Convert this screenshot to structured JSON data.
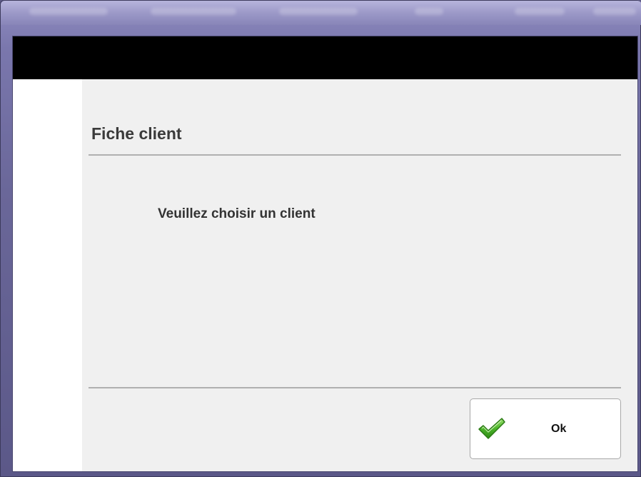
{
  "dialog": {
    "title": "Fiche client",
    "message": "Veuillez choisir un client",
    "ok_label": "Ok"
  },
  "icons": {
    "ok": "checkmark-icon"
  },
  "colors": {
    "header_bar": "#000000",
    "panel_background": "#f0f0f0",
    "checkmark": "#4caf2a"
  }
}
